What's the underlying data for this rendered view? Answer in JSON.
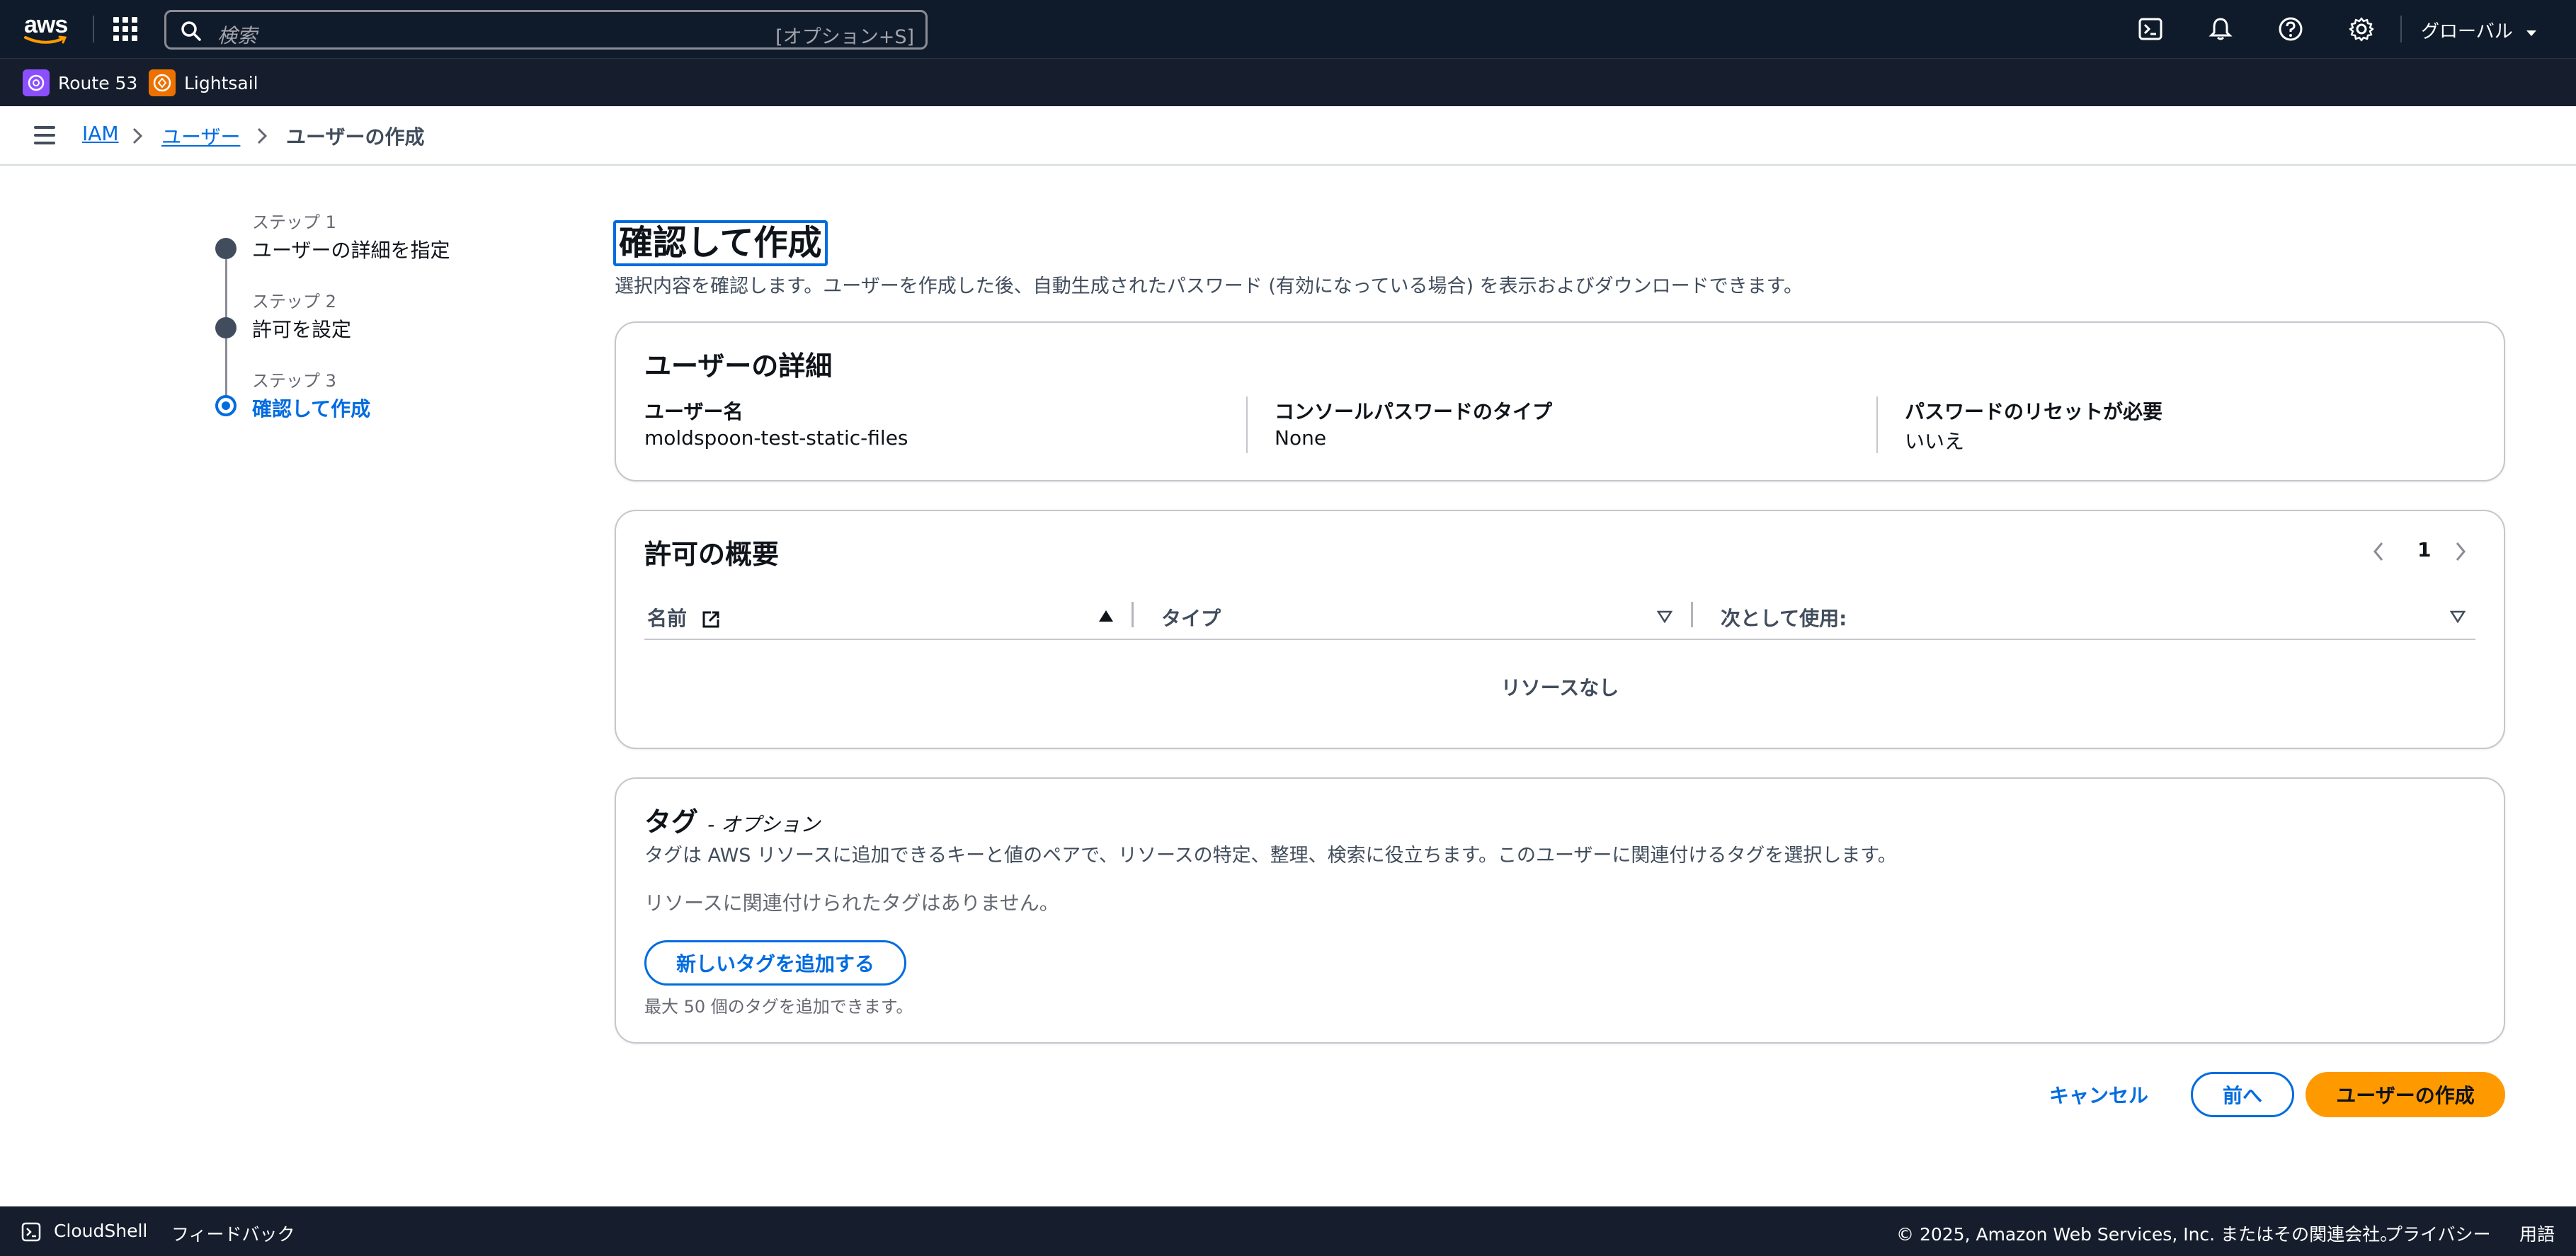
{
  "topnav": {
    "logo": "aws",
    "search_placeholder": "検索",
    "search_shortcut": "[オプション+S]",
    "region": "グローバル"
  },
  "favorites": [
    {
      "label": "Route 53",
      "icon": "route53-icon",
      "color": "#8c4fff"
    },
    {
      "label": "Lightsail",
      "icon": "lightsail-icon",
      "color": "#ed7100"
    }
  ],
  "breadcrumb": {
    "items": [
      "IAM",
      "ユーザー",
      "ユーザーの作成"
    ]
  },
  "steps": [
    {
      "num": "ステップ 1",
      "label": "ユーザーの詳細を指定",
      "active": false
    },
    {
      "num": "ステップ 2",
      "label": "許可を設定",
      "active": false
    },
    {
      "num": "ステップ 3",
      "label": "確認して作成",
      "active": true
    }
  ],
  "page": {
    "title": "確認して作成",
    "description": "選択内容を確認します。ユーザーを作成した後、自動生成されたパスワード (有効になっている場合) を表示およびダウンロードできます。"
  },
  "user_details": {
    "title": "ユーザーの詳細",
    "fields": [
      {
        "key": "ユーザー名",
        "value": "moldspoon-test-static-files"
      },
      {
        "key": "コンソールパスワードのタイプ",
        "value": "None"
      },
      {
        "key": "パスワードのリセットが必要",
        "value": "いいえ"
      }
    ]
  },
  "permissions": {
    "title": "許可の概要",
    "page": "1",
    "columns": [
      "名前",
      "タイプ",
      "次として使用:"
    ],
    "empty_text": "リソースなし"
  },
  "tags": {
    "title": "タグ",
    "optional": "- オプション",
    "description": "タグは AWS リソースに追加できるキーと値のペアで、リソースの特定、整理、検索に役立ちます。このユーザーに関連付けるタグを選択します。",
    "empty_text": "リソースに関連付けられたタグはありません。",
    "add_button": "新しいタグを追加する",
    "hint": "最大 50 個のタグを追加できます。"
  },
  "actions": {
    "cancel": "キャンセル",
    "previous": "前へ",
    "create": "ユーザーの作成"
  },
  "footer": {
    "cloudshell": "CloudShell",
    "feedback": "フィードバック",
    "copyright": "© 2025, Amazon Web Services, Inc. またはその関連会社。",
    "privacy": "プライバシー",
    "terms": "用語"
  },
  "colors": {
    "nav_bg": "#0f1b2a",
    "link": "#006ce0",
    "primary": "#ff9900"
  }
}
